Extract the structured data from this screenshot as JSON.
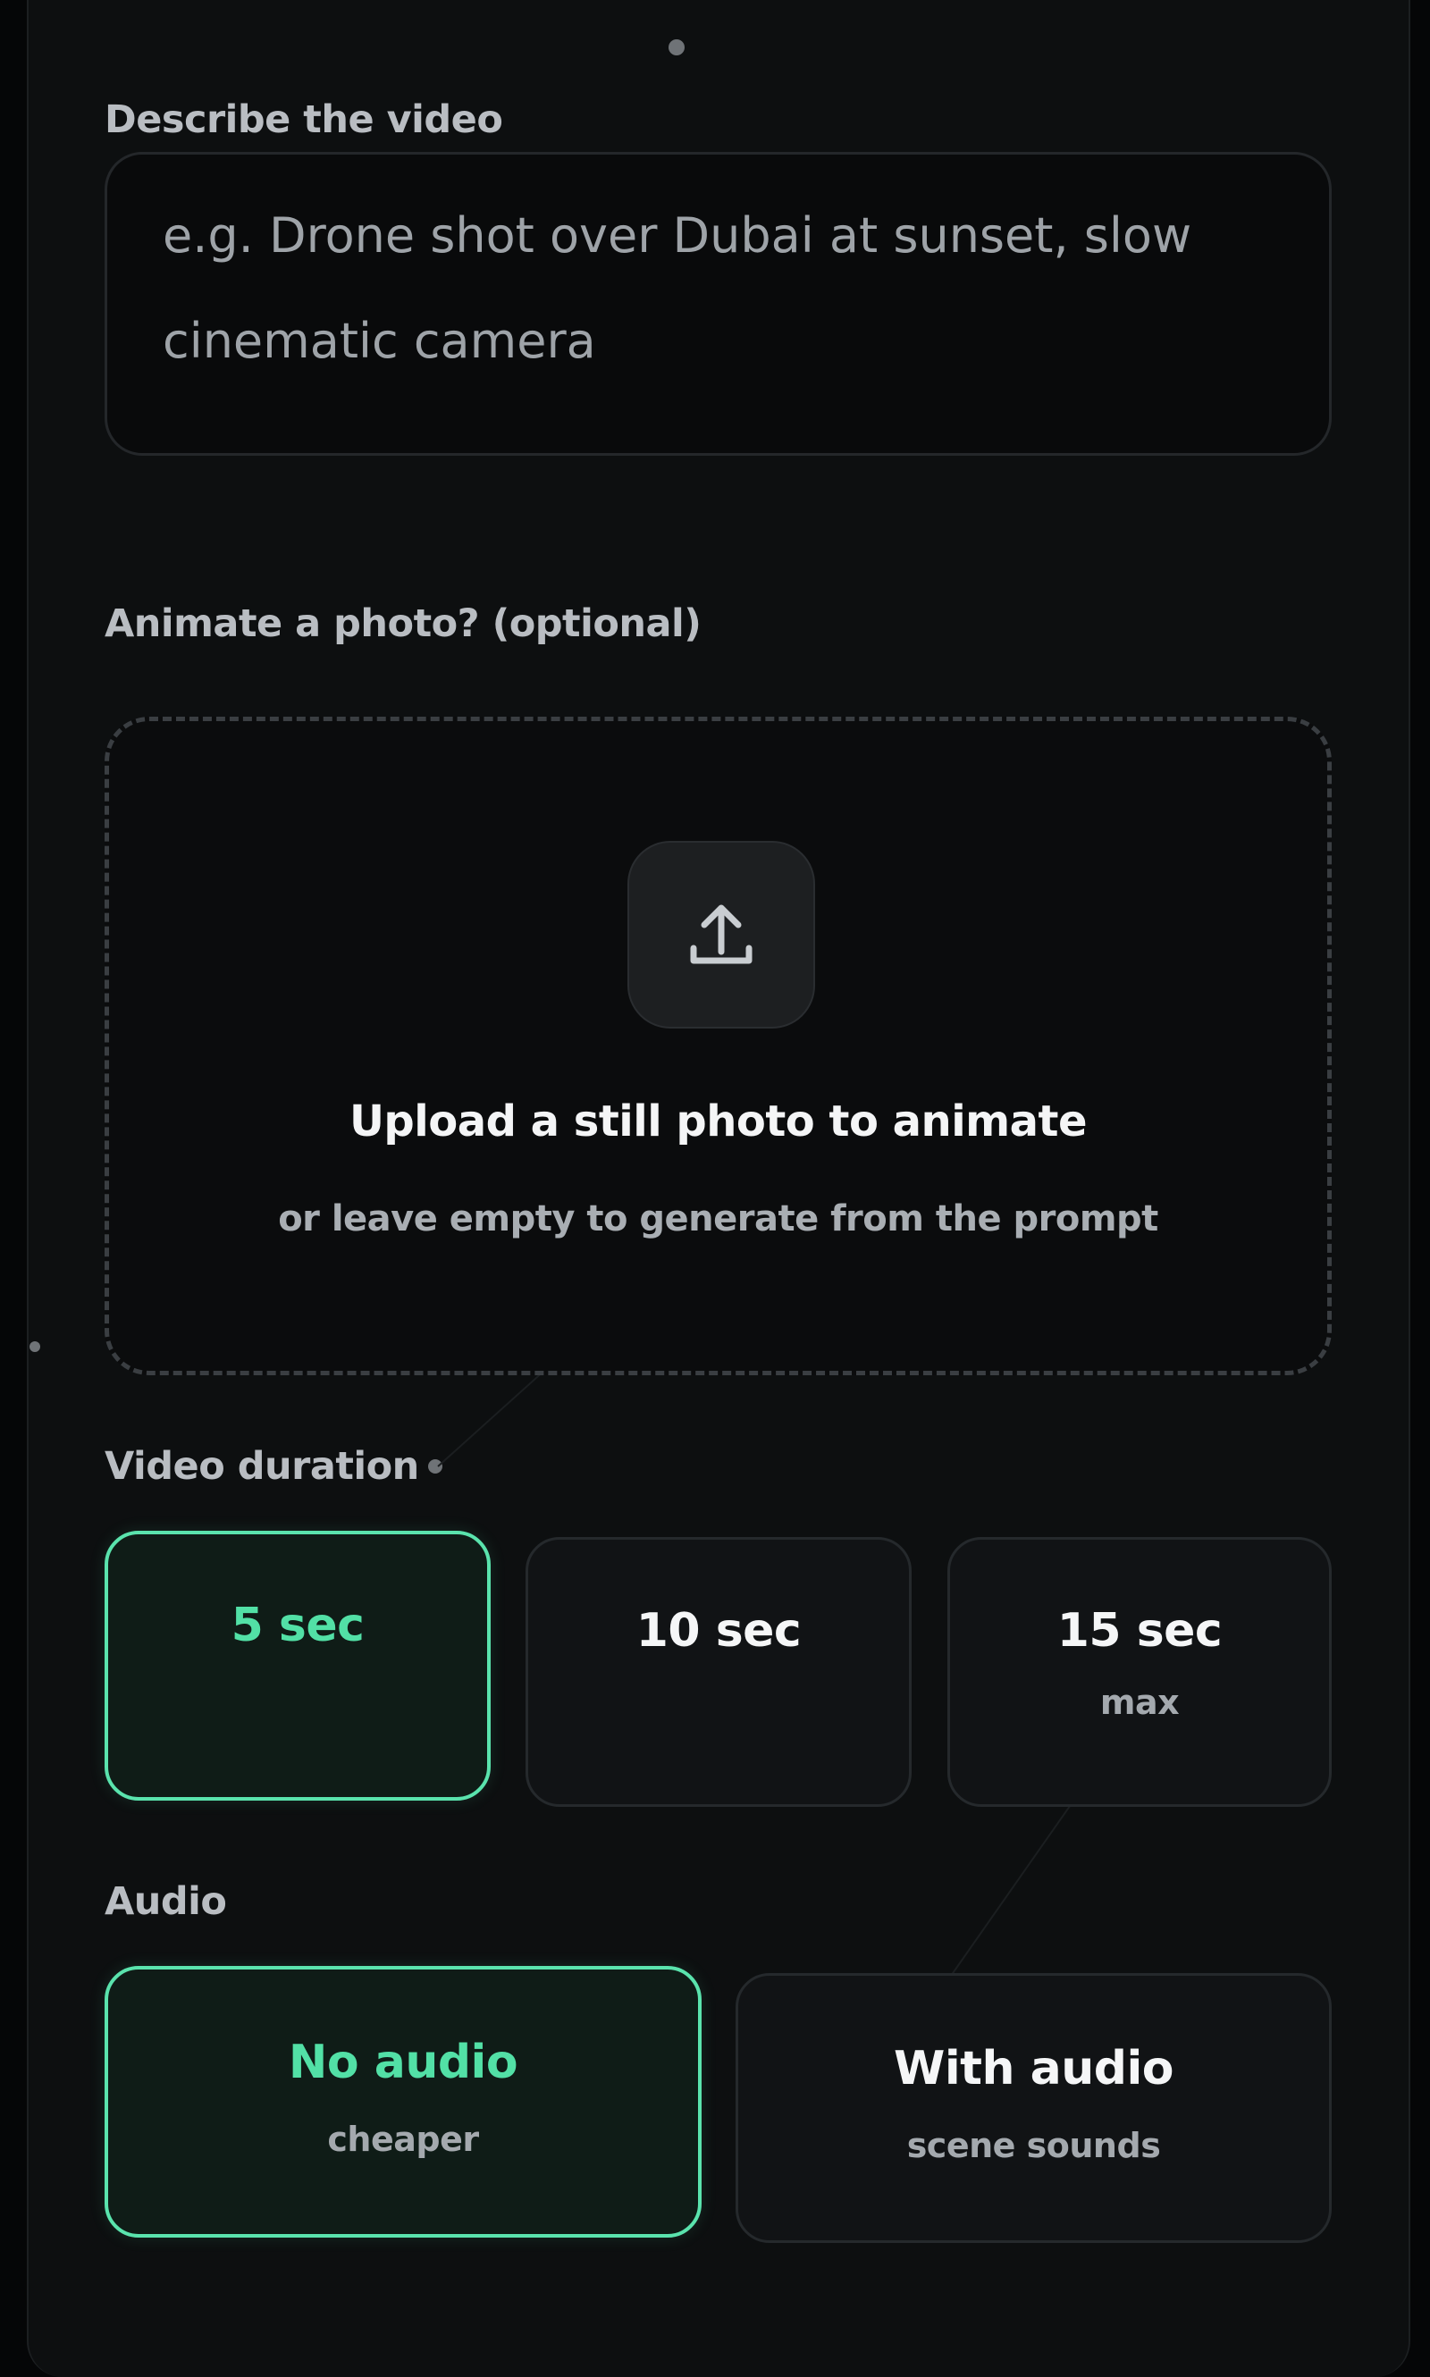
{
  "form": {
    "describe_label": "Describe the video",
    "prompt_placeholder_line1": "e.g. Drone shot over Dubai at sunset, slow",
    "prompt_placeholder_line2": "cinematic camera",
    "photo_label": "Animate a photo? (optional)",
    "upload_title": "Upload a still photo to animate",
    "upload_subtitle": "or leave empty to generate from the prompt",
    "duration_label": "Video duration",
    "durations": [
      {
        "label": "5 sec",
        "note": "",
        "selected": true
      },
      {
        "label": "10 sec",
        "note": "",
        "selected": false
      },
      {
        "label": "15 sec",
        "note": "max",
        "selected": false
      }
    ],
    "audio_label": "Audio",
    "audio_options": [
      {
        "label": "No audio",
        "note": "cheaper",
        "selected": true
      },
      {
        "label": "With audio",
        "note": "scene sounds",
        "selected": false
      }
    ]
  },
  "icons": {
    "upload": "upload-tray-icon"
  },
  "colors": {
    "accent": "#52e0a6",
    "background": "#0d0f10",
    "selected_fill": "#0f1c17"
  }
}
